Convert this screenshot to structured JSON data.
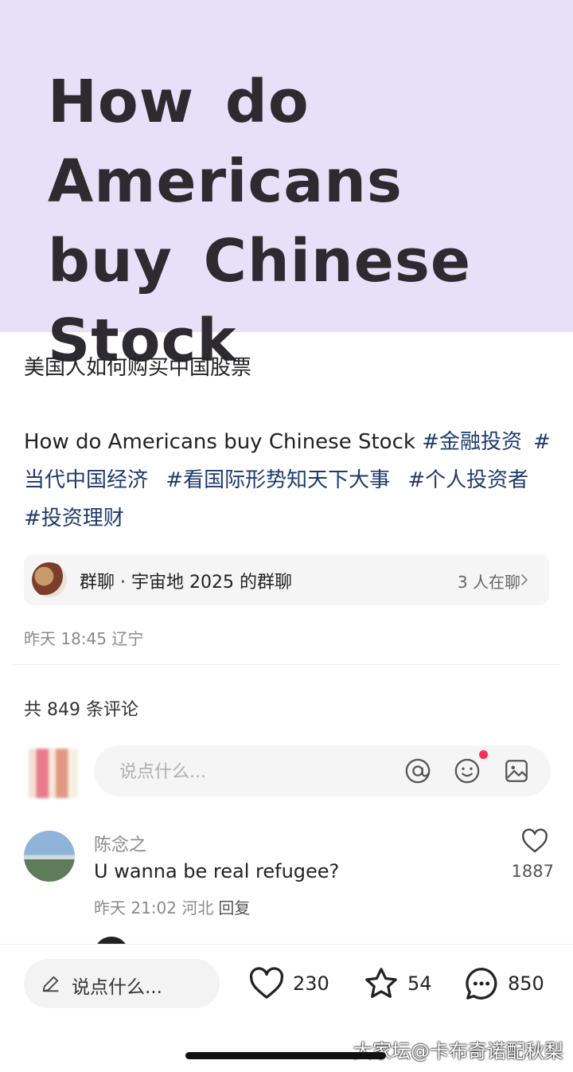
{
  "hero": {
    "title": "How do Americans buy Chinese Stock"
  },
  "post": {
    "title": "美国人如何购买中国股票",
    "body": "How do Americans buy Chinese Stock",
    "tags": [
      "#金融投资",
      "#当代中国经济",
      "#看国际形势知天下大事",
      "#个人投资者",
      "#投资理财"
    ],
    "meta": "昨天 18:45 辽宁"
  },
  "group": {
    "name": "群聊 · 宇宙地 2025 的群聊",
    "count": "3 人在聊"
  },
  "comments_header": {
    "count_label": "共 849 条评论"
  },
  "comment_input": {
    "placeholder": "说点什么..."
  },
  "comment": {
    "author": "陈念之",
    "text": "U wanna be real refugee?",
    "time": "昨天 21:02 河北",
    "reply": "回复",
    "likes": "1887"
  },
  "bottom_bar": {
    "input_label": "说点什么...",
    "likes": "230",
    "stars": "54",
    "comments": "850"
  },
  "watermark": "大家坛@卡布奇诺配秋梨",
  "icons": [
    "at-icon",
    "emoji-icon",
    "image-icon",
    "heart-icon",
    "star-icon",
    "comment-icon",
    "pencil-icon",
    "chevron-right-icon"
  ],
  "colors": {
    "hero_bg": "#e6e1f8",
    "tag": "#1e3a6e",
    "notification_dot": "#ff2d55"
  }
}
